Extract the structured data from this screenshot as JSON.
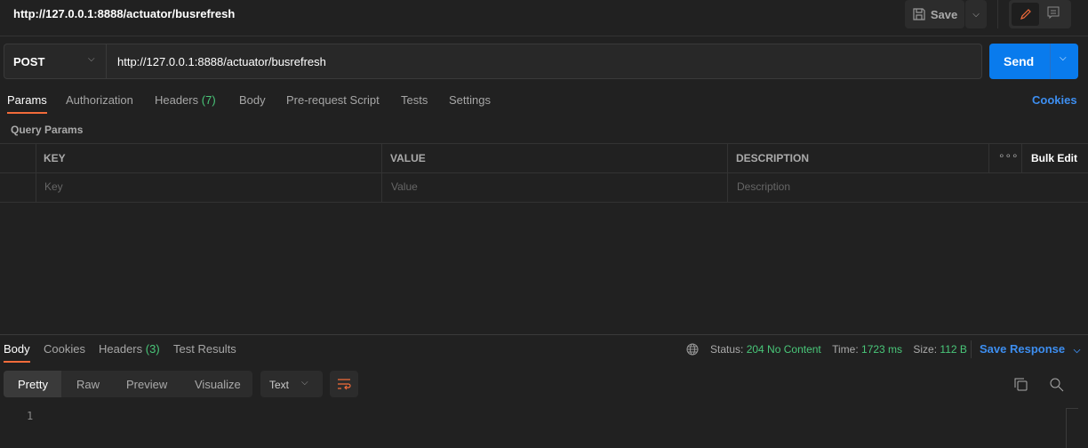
{
  "header": {
    "title": "http://127.0.0.1:8888/actuator/busrefresh",
    "save_label": "Save"
  },
  "request": {
    "method": "POST",
    "url": "http://127.0.0.1:8888/actuator/busrefresh",
    "send_label": "Send"
  },
  "tabs": [
    {
      "label": "Params"
    },
    {
      "label": "Authorization"
    },
    {
      "label": "Headers"
    },
    {
      "label": "Body"
    },
    {
      "label": "Pre-request Script"
    },
    {
      "label": "Tests"
    },
    {
      "label": "Settings"
    }
  ],
  "headers_count": "(7)",
  "cookies_label": "Cookies",
  "query_params": {
    "title": "Query Params",
    "columns": {
      "key": "KEY",
      "value": "VALUE",
      "description": "DESCRIPTION"
    },
    "bulk_edit": "Bulk Edit",
    "placeholders": {
      "key": "Key",
      "value": "Value",
      "description": "Description"
    }
  },
  "response": {
    "tabs": [
      {
        "label": "Body"
      },
      {
        "label": "Cookies"
      },
      {
        "label": "Headers"
      },
      {
        "label": "Test Results"
      }
    ],
    "headers_count": "(3)",
    "status_label": "Status:",
    "status": "204 No Content",
    "time_label": "Time:",
    "time": "1723 ms",
    "size_label": "Size:",
    "size": "112 B",
    "save_response": "Save Response",
    "views": [
      {
        "label": "Pretty"
      },
      {
        "label": "Raw"
      },
      {
        "label": "Preview"
      },
      {
        "label": "Visualize"
      }
    ],
    "format": "Text",
    "line_number": "1"
  },
  "colors": {
    "accent": "#f26b3a",
    "send": "#097bed",
    "link": "#3d8ef0",
    "success": "#49c779"
  }
}
